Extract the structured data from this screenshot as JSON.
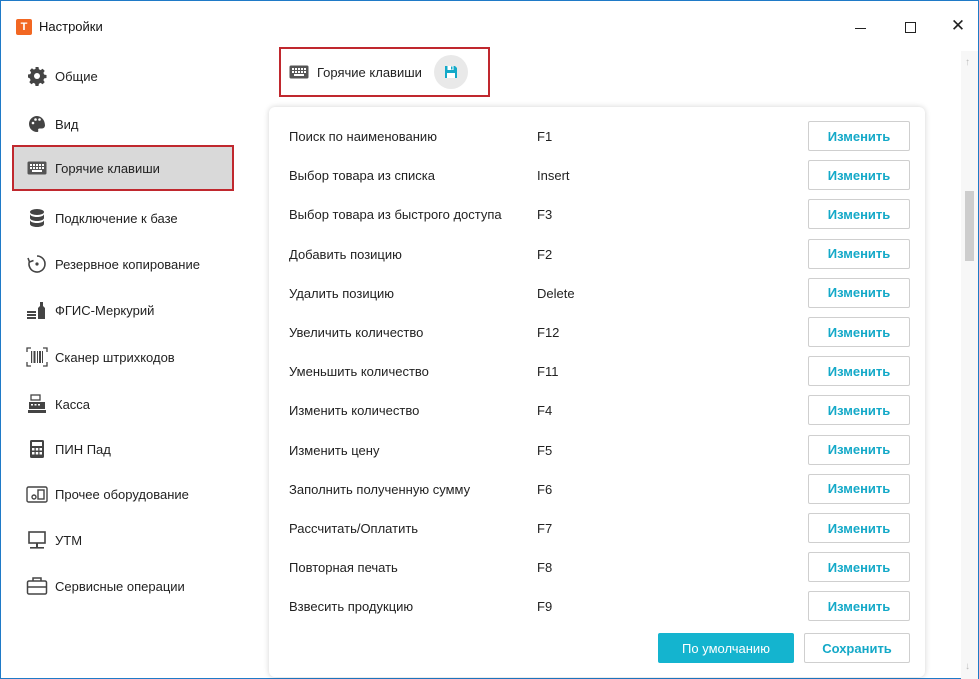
{
  "window": {
    "title": "Настройки",
    "app_icon_letter": "T",
    "app_icon_color": "#f26722"
  },
  "sidebar": {
    "items": [
      {
        "label": "Общие",
        "icon": "gear-icon"
      },
      {
        "label": "Вид",
        "icon": "palette-icon"
      },
      {
        "label": "Горячие клавиши",
        "icon": "keyboard-icon",
        "active": true
      },
      {
        "label": "Подключение к базе",
        "icon": "database-icon"
      },
      {
        "label": "Резервное копирование",
        "icon": "backup-icon"
      },
      {
        "label": "ФГИС-Меркурий",
        "icon": "mercury-icon"
      },
      {
        "label": "Сканер штрихкодов",
        "icon": "barcode-icon"
      },
      {
        "label": "Касса",
        "icon": "cash-register-icon"
      },
      {
        "label": "ПИН Пад",
        "icon": "calculator-icon"
      },
      {
        "label": "Прочее оборудование",
        "icon": "equipment-icon"
      },
      {
        "label": "УТМ",
        "icon": "monitor-icon"
      },
      {
        "label": "Сервисные операции",
        "icon": "toolbox-icon"
      }
    ]
  },
  "header": {
    "title": "Горячие клавиши",
    "icon": "keyboard-icon",
    "save_icon": "floppy-disk-icon"
  },
  "hotkeys": [
    {
      "action": "Поиск по наименованию",
      "key": "F1",
      "button": "Изменить"
    },
    {
      "action": "Выбор товара из списка",
      "key": "Insert",
      "button": "Изменить"
    },
    {
      "action": "Выбор товара из быстрого доступа",
      "key": "F3",
      "button": "Изменить"
    },
    {
      "action": "Добавить позицию",
      "key": "F2",
      "button": "Изменить"
    },
    {
      "action": "Удалить позицию",
      "key": "Delete",
      "button": "Изменить"
    },
    {
      "action": "Увеличить количество",
      "key": "F12",
      "button": "Изменить"
    },
    {
      "action": "Уменьшить количество",
      "key": "F11",
      "button": "Изменить"
    },
    {
      "action": "Изменить количество",
      "key": "F4",
      "button": "Изменить"
    },
    {
      "action": "Изменить цену",
      "key": "F5",
      "button": "Изменить"
    },
    {
      "action": "Заполнить полученную сумму",
      "key": "F6",
      "button": "Изменить"
    },
    {
      "action": "Рассчитать/Оплатить",
      "key": "F7",
      "button": "Изменить"
    },
    {
      "action": "Повторная печать",
      "key": "F8",
      "button": "Изменить"
    },
    {
      "action": "Взвесить продукцию",
      "key": "F9",
      "button": "Изменить"
    }
  ],
  "footer": {
    "default_label": "По умолчанию",
    "save_label": "Сохранить"
  },
  "colors": {
    "accent": "#14b4cf",
    "link_text": "#14a9c8",
    "highlight_border": "#c0282e",
    "active_bg": "#d9d9d9"
  }
}
